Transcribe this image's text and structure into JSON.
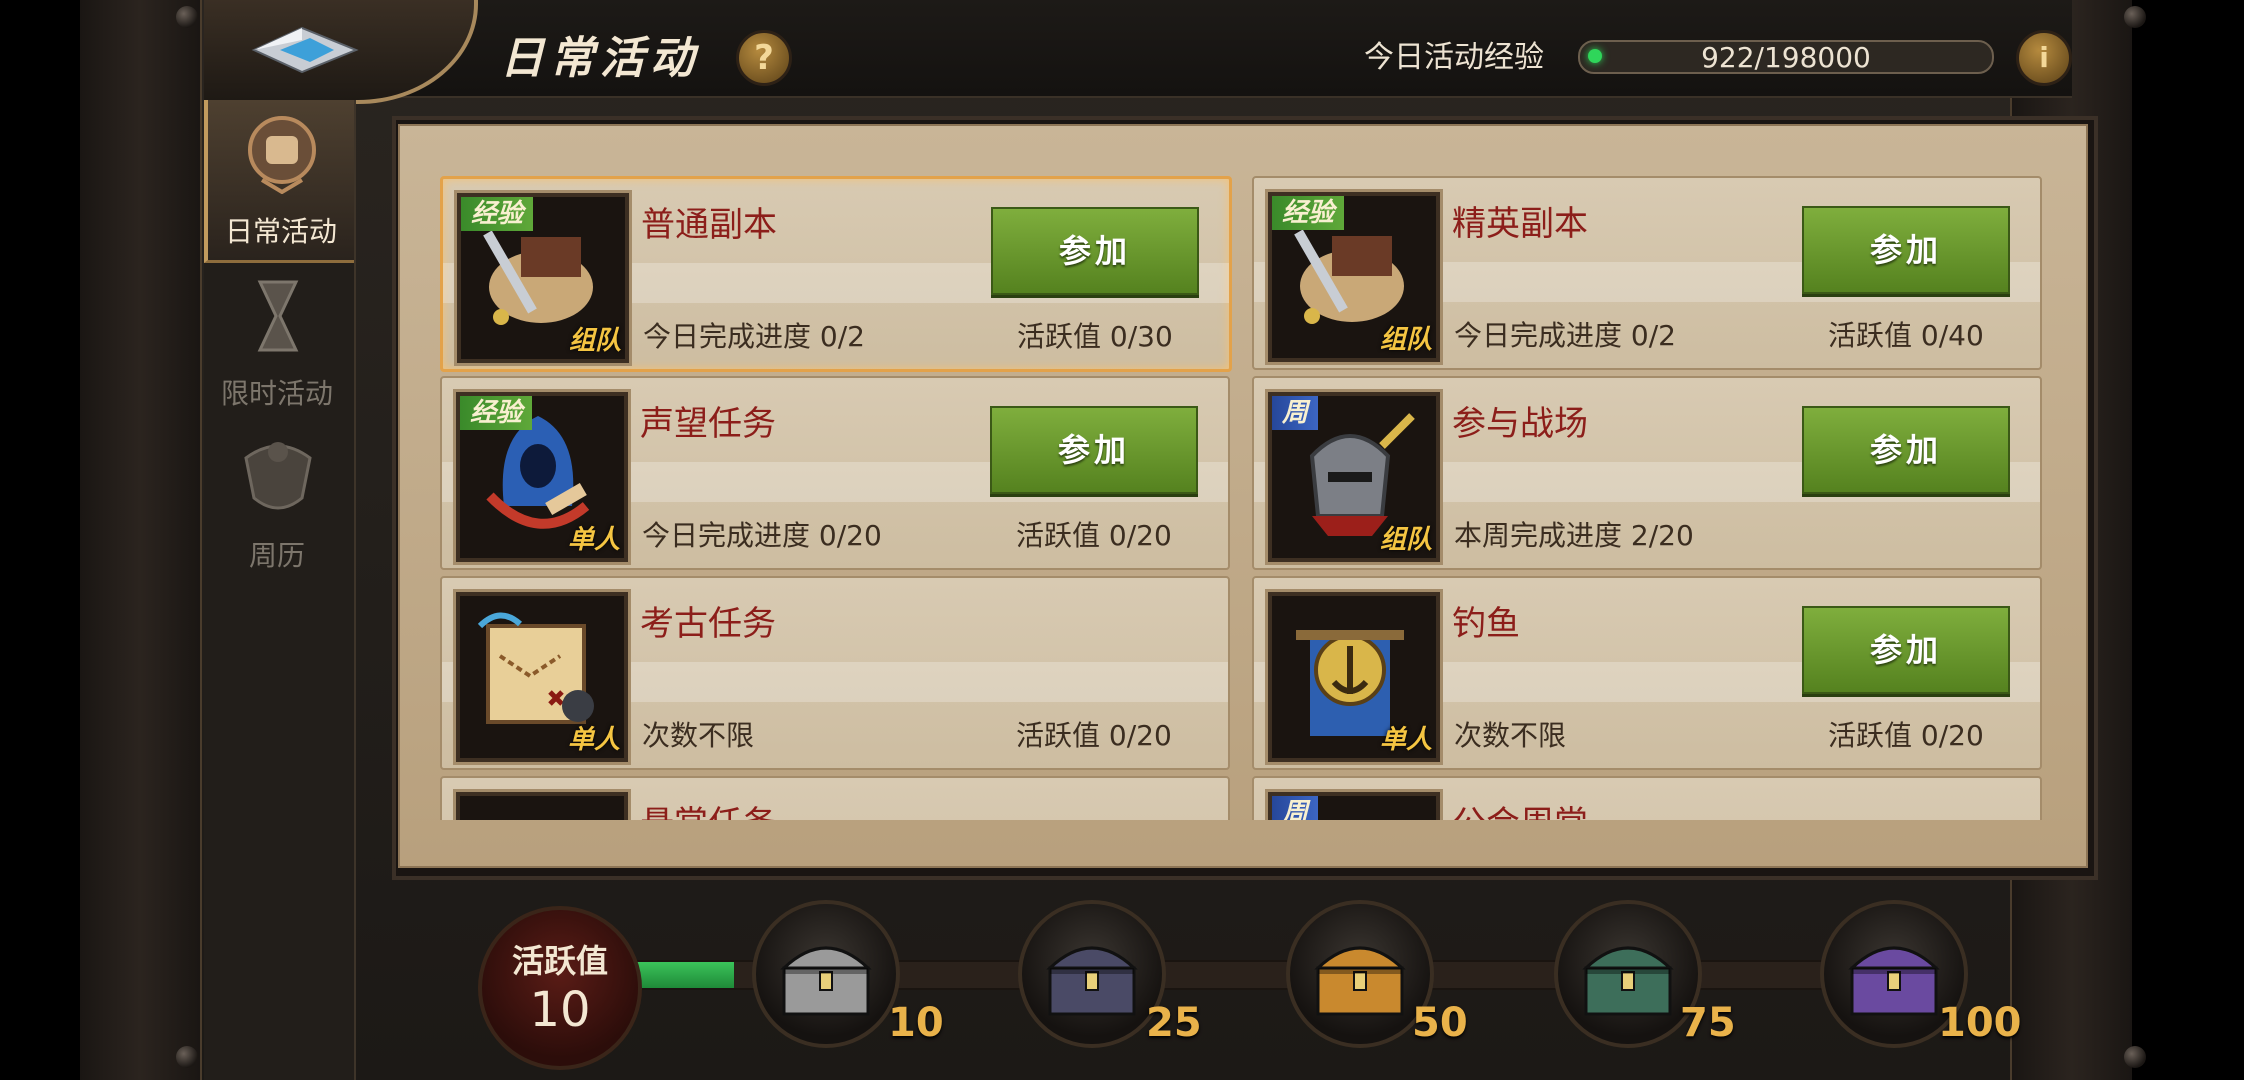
{
  "header": {
    "title": "日常活动",
    "help_label": "?",
    "exp_label": "今日活动经验",
    "exp_value": "922/198000",
    "exp_fraction": 0.0047,
    "info_label": "i"
  },
  "sidebar": {
    "tabs": [
      {
        "label": "日常活动",
        "active": true,
        "icon": "scroll-emblem-icon"
      },
      {
        "label": "限时活动",
        "active": false,
        "icon": "hourglass-icon"
      },
      {
        "label": "周历",
        "active": false,
        "icon": "calendar-emblem-icon"
      }
    ]
  },
  "activities": [
    {
      "name": "普通副本",
      "tag": "经验",
      "tag_color": "green",
      "group": "组队",
      "icon": "sword-scroll-icon",
      "progress": "今日完成进度  0/2",
      "active": "活跃值  0/30",
      "button": "参加",
      "selected": true
    },
    {
      "name": "精英副本",
      "tag": "经验",
      "tag_color": "green",
      "group": "组队",
      "icon": "sword-scroll-icon",
      "progress": "今日完成进度  0/2",
      "active": "活跃值  0/40",
      "button": "参加",
      "selected": false
    },
    {
      "name": "声望任务",
      "tag": "经验",
      "tag_color": "green",
      "group": "单人",
      "icon": "hooded-figure-icon",
      "progress": "今日完成进度  0/20",
      "active": "活跃值  0/20",
      "button": "参加",
      "selected": false
    },
    {
      "name": "参与战场",
      "tag": "周",
      "tag_color": "blue",
      "group": "组队",
      "icon": "knight-helmet-icon",
      "progress": "本周完成进度  2/20",
      "active": "",
      "button": "参加",
      "selected": false
    },
    {
      "name": "考古任务",
      "tag": "",
      "tag_color": "",
      "group": "单人",
      "icon": "treasure-map-icon",
      "progress": "次数不限",
      "active": "活跃值  0/20",
      "button": "",
      "selected": false
    },
    {
      "name": "钓鱼",
      "tag": "",
      "tag_color": "",
      "group": "单人",
      "icon": "anchor-banner-icon",
      "progress": "次数不限",
      "active": "活跃值  0/20",
      "button": "参加",
      "selected": false
    },
    {
      "name": "悬赏任务",
      "tag": "",
      "tag_color": "",
      "group": "",
      "icon": "bounty-icon",
      "progress": "",
      "active": "",
      "button": "",
      "selected": false
    },
    {
      "name": "公会周常",
      "tag": "周",
      "tag_color": "blue",
      "group": "",
      "icon": "guild-icon",
      "progress": "",
      "active": "",
      "button": "",
      "selected": false
    }
  ],
  "rewards": {
    "active_label": "活跃值",
    "active_value": "10",
    "progress_fraction": 0.1,
    "chests": [
      {
        "threshold": "10",
        "icon": "silver-chest-icon",
        "color": "#9a9a9a"
      },
      {
        "threshold": "25",
        "icon": "dark-chest-icon",
        "color": "#4a4a66"
      },
      {
        "threshold": "50",
        "icon": "gold-chest-icon",
        "color": "#c9892e"
      },
      {
        "threshold": "75",
        "icon": "emerald-chest-icon",
        "color": "#3d6e5a"
      },
      {
        "threshold": "100",
        "icon": "purple-chest-icon",
        "color": "#6a4aa0"
      }
    ]
  }
}
